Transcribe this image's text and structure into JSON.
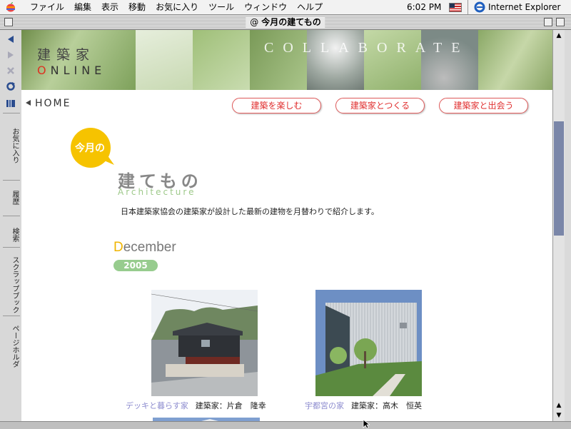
{
  "menubar": {
    "menus": [
      "ファイル",
      "編集",
      "表示",
      "移動",
      "お気に入り",
      "ツール",
      "ウィンドウ",
      "ヘルプ"
    ],
    "clock": "6:02 PM",
    "app_name": "Internet Explorer"
  },
  "window": {
    "title_at": "@",
    "title": "今月の建てもの"
  },
  "explorer_tabs": [
    "お気に入り",
    "履歴",
    "検索",
    "スクラップブック",
    "ページホルダ"
  ],
  "page": {
    "brand_kanji": "建築家",
    "brand_online_o": "O",
    "brand_online_rest": "NLINE",
    "banner_word": "COLLABORATE",
    "home_label": "HOME",
    "nav_buttons": [
      "建築を楽しむ",
      "建築家とつくる",
      "建築家と出会う"
    ],
    "badge": "今月の",
    "title_kanji": "建てもの",
    "title_en": "Architecture",
    "intro": "日本建築家協会の建築家が設計した最新の建物を月替わりで紹介します。",
    "month_initial": "D",
    "month_rest": "ecember",
    "year": "2005",
    "works": [
      {
        "name": "デッキと暮らす家",
        "architect": "建築家：片倉　隆幸"
      },
      {
        "name": "宇都宮の家",
        "architect": "建築家：高木　恒英"
      }
    ]
  },
  "colors": {
    "accent_red": "#e03030",
    "accent_green": "#97cc8e",
    "accent_yellow": "#f0b400",
    "link_purple": "#8d8ccf",
    "scroll_thumb": "#7a86a8"
  }
}
